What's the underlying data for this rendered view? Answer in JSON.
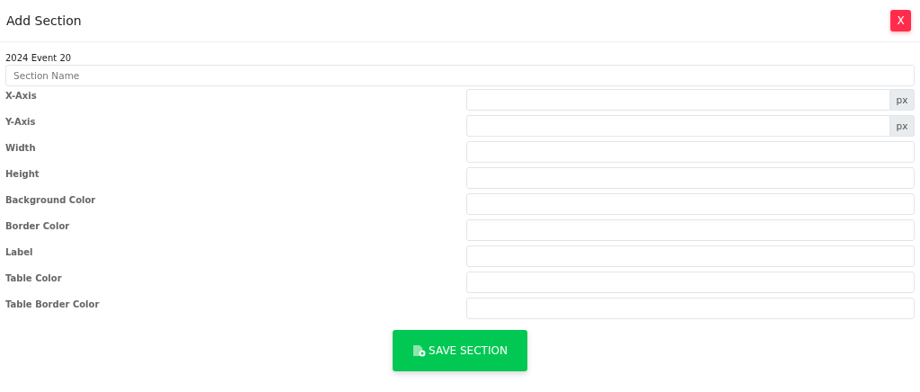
{
  "header": {
    "title": "Add Section",
    "close_button": "X"
  },
  "event": "2024 Event 20",
  "section_name": {
    "placeholder": "Section Name"
  },
  "fields": [
    {
      "label": "X-Axis",
      "suffix": "px"
    },
    {
      "label": "Y-Axis",
      "suffix": "px"
    },
    {
      "label": "Width"
    },
    {
      "label": "Height"
    },
    {
      "label": "Background Color"
    },
    {
      "label": "Border Color"
    },
    {
      "label": "Label"
    },
    {
      "label": "Table Color"
    },
    {
      "label": "Table Border Color"
    }
  ],
  "save_button": "SAVE SECTION"
}
